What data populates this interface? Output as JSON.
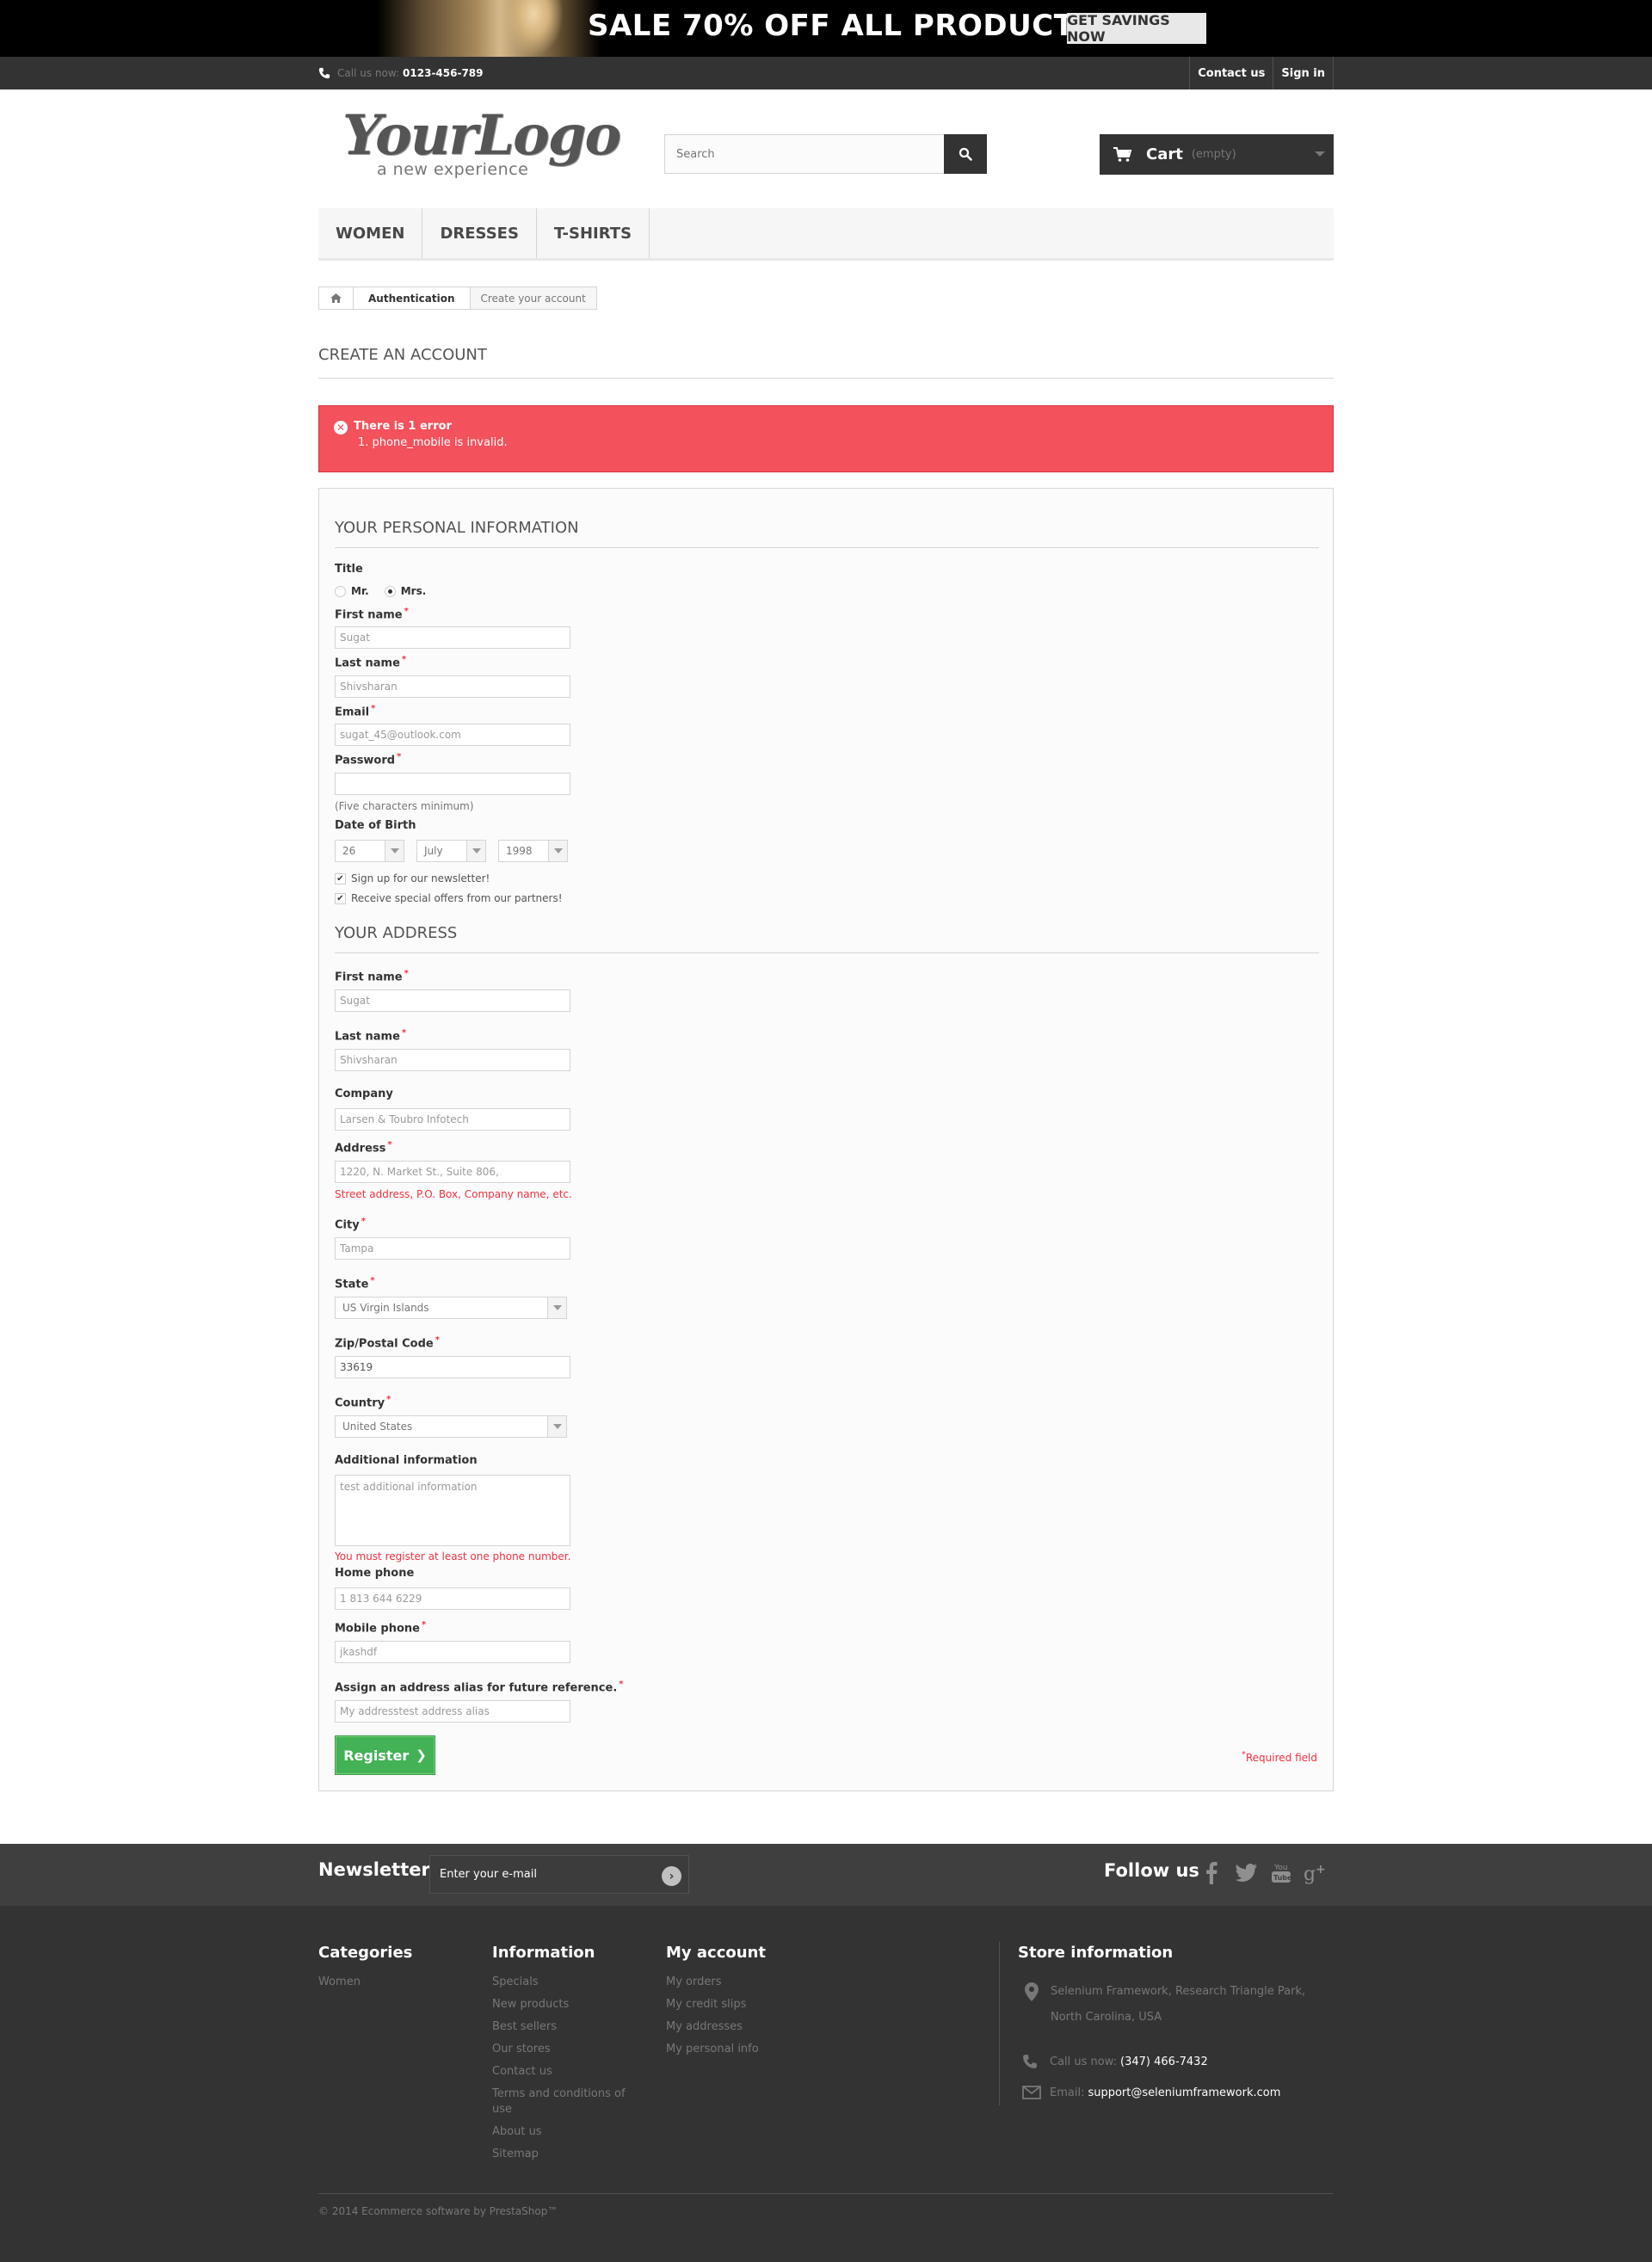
{
  "banner": {
    "text": "SALE 70% OFF ALL PRODUCTS",
    "button": "GET SAVINGS NOW"
  },
  "topnav": {
    "call_label": "Call us now:",
    "phone": "0123-456-789",
    "contact": "Contact us",
    "signin": "Sign in"
  },
  "header": {
    "logo_main": "YourLogo",
    "logo_sub": "a new experience",
    "search_placeholder": "Search",
    "cart_label": "Cart",
    "cart_status": "(empty)"
  },
  "menu": [
    "Women",
    "Dresses",
    "T-shirts"
  ],
  "breadcrumb": {
    "crumb": "Authentication",
    "current": "Create your account"
  },
  "page_title": "Create an account",
  "alert": {
    "title": "There is 1 error",
    "message": "1. phone_mobile is invalid."
  },
  "personal": {
    "section_title": "Your personal information",
    "title_label": "Title",
    "title_options": [
      "Mr.",
      "Mrs."
    ],
    "title_selected": "Mrs.",
    "first_name_label": "First name",
    "first_name": "Sugat",
    "last_name_label": "Last name",
    "last_name": "Shivsharan",
    "email_label": "Email",
    "email": "sugat_45@outlook.com",
    "password_label": "Password",
    "password": "",
    "password_hint": "(Five characters minimum)",
    "dob_label": "Date of Birth",
    "dob_day": "26",
    "dob_month": "July",
    "dob_year": "1998",
    "newsletter_label": "Sign up for our newsletter!",
    "newsletter_checked": true,
    "offers_label": "Receive special offers from our partners!",
    "offers_checked": true
  },
  "address": {
    "section_title": "Your address",
    "first_name_label": "First name",
    "first_name": "Sugat",
    "last_name_label": "Last name",
    "last_name": "Shivsharan",
    "company_label": "Company",
    "company": "Larsen & Toubro Infotech",
    "address_label": "Address",
    "address": "1220, N. Market St., Suite 806,",
    "address_hint": "Street address, P.O. Box, Company name, etc.",
    "city_label": "City",
    "city": "Tampa",
    "state_label": "State",
    "state": "US Virgin Islands",
    "zip_label": "Zip/Postal Code",
    "zip": "33619",
    "country_label": "Country",
    "country": "United States",
    "additional_label": "Additional information",
    "additional": "test additional information",
    "phone_warning": "You must register at least one phone number.",
    "home_phone_label": "Home phone",
    "home_phone": "1 813 644 6229",
    "mobile_phone_label": "Mobile phone",
    "mobile_phone": "jkashdf",
    "alias_label": "Assign an address alias for future reference.",
    "alias": "My addresstest address alias",
    "register_button": "Register",
    "required_note": "Required field"
  },
  "newsletter": {
    "title": "Newsletter",
    "input_placeholder": "Enter your e-mail",
    "follow_title": "Follow us",
    "social_icons": [
      "facebook-icon",
      "twitter-icon",
      "youtube-icon",
      "google-plus-icon"
    ]
  },
  "footer": {
    "categories_title": "Categories",
    "categories": [
      "Women"
    ],
    "information_title": "Information",
    "information": [
      "Specials",
      "New products",
      "Best sellers",
      "Our stores",
      "Contact us",
      "Terms and conditions of use",
      "About us",
      "Sitemap"
    ],
    "account_title": "My account",
    "account": [
      "My orders",
      "My credit slips",
      "My addresses",
      "My personal info"
    ],
    "store_title": "Store information",
    "store_address": "Selenium Framework, Research Triangle Park, North Carolina, USA",
    "store_call_label": "Call us now:",
    "store_phone": "(347) 466-7432",
    "store_email_label": "Email:",
    "store_email": "support@seleniumframework.com",
    "copyright": "© 2014 Ecommerce software by PrestaShop™"
  },
  "colors": {
    "alert_bg": "#f3515c",
    "register_green": "#43b155",
    "required_red": "#f13340",
    "dark_bg": "#333333"
  }
}
